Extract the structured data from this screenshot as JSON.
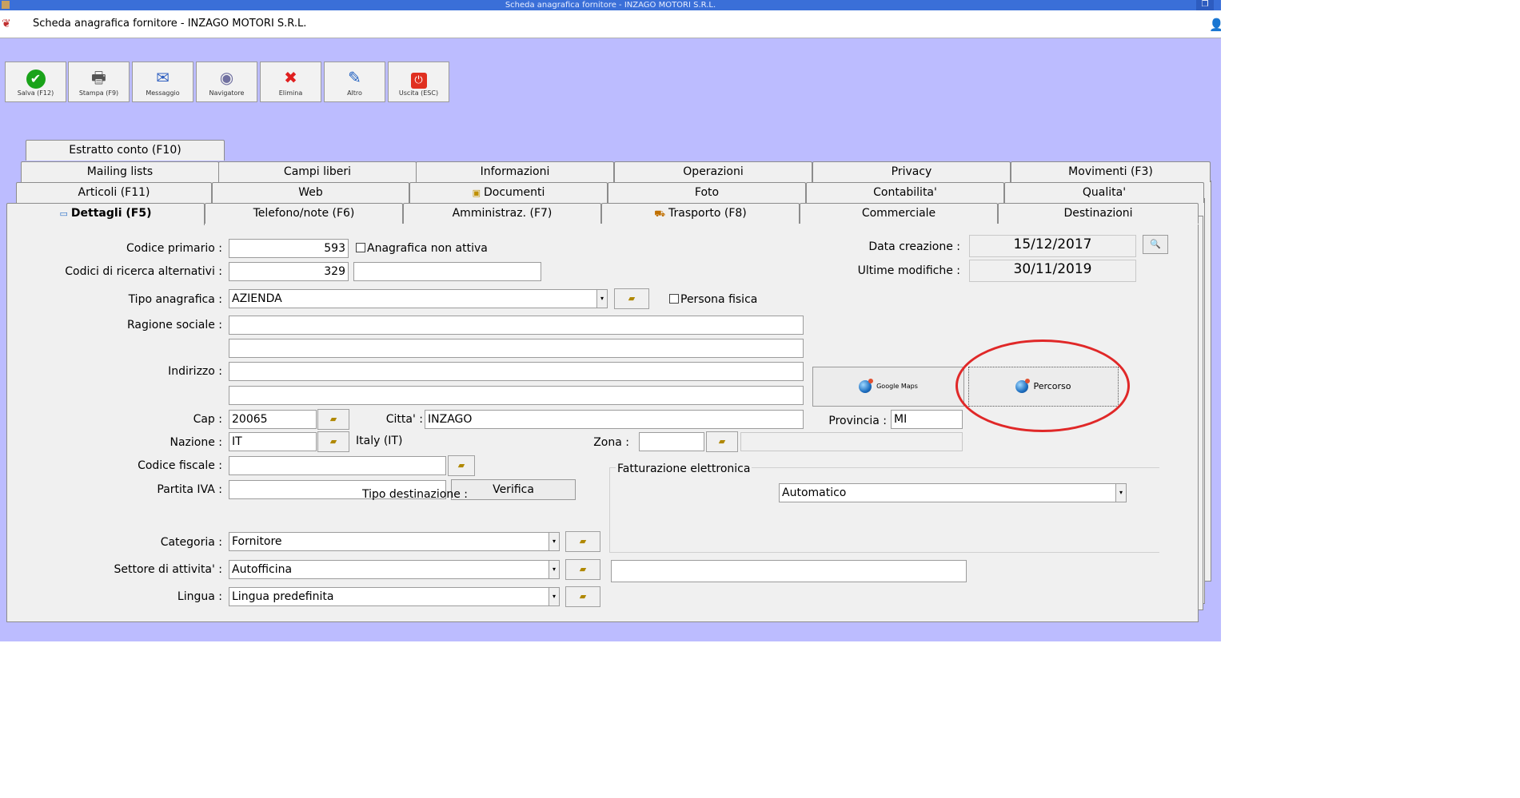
{
  "window": {
    "title": "Scheda anagrafica fornitore - INZAGO MOTORI S.R.L.",
    "header_title": "Scheda anagrafica fornitore - INZAGO MOTORI S.R.L."
  },
  "toolbar": [
    {
      "label": "Salva (F12)",
      "icon": "check-icon",
      "color": "#1aa31a"
    },
    {
      "label": "Stampa (F9)",
      "icon": "printer-icon",
      "color": "#555555"
    },
    {
      "label": "Messaggio",
      "icon": "message-icon",
      "color": "#3060c0"
    },
    {
      "label": "Navigatore",
      "icon": "navigator-icon",
      "color": "#7070a0"
    },
    {
      "label": "Elimina",
      "icon": "delete-x-icon",
      "color": "#e02020"
    },
    {
      "label": "Altro",
      "icon": "other-icon",
      "color": "#2060c0"
    },
    {
      "label": "Uscita (ESC)",
      "icon": "exit-icon",
      "color": "#e03020"
    }
  ],
  "tabs": {
    "row0": [
      "Estratto conto (F10)"
    ],
    "row1": [
      "Mailing lists",
      "Campi liberi",
      "Informazioni",
      "Operazioni",
      "Privacy",
      "Movimenti (F3)"
    ],
    "row2": [
      "Articoli (F11)",
      "Web",
      "Documenti",
      "Foto",
      "Contabilita'",
      "Qualita'"
    ],
    "row3": [
      "Dettagli (F5)",
      "Telefono/note (F6)",
      "Amministraz. (F7)",
      "Trasporto (F8)",
      "Commerciale",
      "Destinazioni"
    ]
  },
  "form": {
    "codice_primario_label": "Codice primario :",
    "codice_primario": "593",
    "anagrafica_non_attiva": "Anagrafica non attiva",
    "codici_ricerca_label": "Codici di ricerca alternativi :",
    "codici_ricerca": "329",
    "tipo_anagrafica_label": "Tipo anagrafica :",
    "tipo_anagrafica": "AZIENDA",
    "persona_fisica": "Persona fisica",
    "ragione_sociale_label": "Ragione sociale :",
    "indirizzo_label": "Indirizzo :",
    "cap_label": "Cap :",
    "cap": "20065",
    "citta_label": "Citta' :",
    "citta": "INZAGO",
    "provincia_label": "Provincia :",
    "provincia": "MI",
    "nazione_label": "Nazione :",
    "nazione": "IT",
    "nazione_desc": "Italy (IT)",
    "zona_label": "Zona :",
    "codice_fiscale_label": "Codice fiscale :",
    "partita_iva_label": "Partita IVA :",
    "verifica": "Verifica",
    "fatturazione_label": "Fatturazione elettronica",
    "tipo_destinazione_label": "Tipo destinazione :",
    "tipo_destinazione": "Automatico",
    "categoria_label": "Categoria :",
    "categoria": "Fornitore",
    "settore_label": "Settore di attivita' :",
    "settore": "Autofficina",
    "lingua_label": "Lingua :",
    "lingua": "Lingua predefinita",
    "data_creazione_label": "Data creazione :",
    "data_creazione": "15/12/2017",
    "ultime_modifiche_label": "Ultime modifiche :",
    "ultime_modifiche": "30/11/2019",
    "google_maps": "Google Maps",
    "percorso": "Percorso"
  },
  "annotation": {
    "color": "#e02828"
  }
}
